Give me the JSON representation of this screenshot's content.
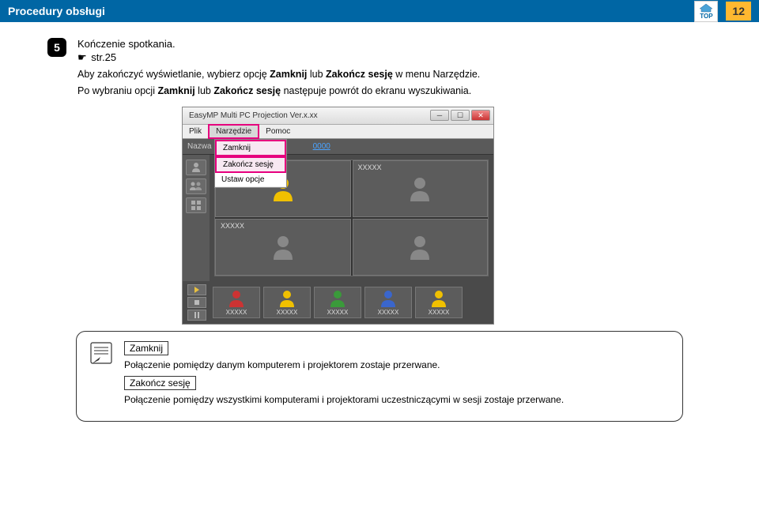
{
  "header": {
    "title": "Procedury obsługi",
    "page_number": "12",
    "top_label": "TOP"
  },
  "step": {
    "number": "5",
    "title": "Kończenie spotkania.",
    "ref_icon": "☛",
    "ref": "str.25",
    "para1_pre": "Aby zakończyć wyświetlanie, wybierz opcję ",
    "para1_b1": "Zamknij",
    "para1_mid": " lub ",
    "para1_b2": "Zakończ sesję",
    "para1_post": " w menu Narzędzie.",
    "para2_pre": "Po wybraniu opcji ",
    "para2_b1": "Zamknij",
    "para2_mid": " lub ",
    "para2_b2": "Zakończ sesję",
    "para2_post": " następuje powrót do ekranu wyszukiwania."
  },
  "app": {
    "title": "EasyMP Multi PC Projection Ver.x.xx",
    "menu": {
      "plik": "Plik",
      "narzedzie": "Narzędzie",
      "pomoc": "Pomoc"
    },
    "toolbar": {
      "nazwa": "Nazwa",
      "link": "0000"
    },
    "dropdown": {
      "zamknij": "Zamknij",
      "zakoncz": "Zakończ sesję",
      "ustaw": "Ustaw opcje"
    },
    "cells": {
      "a": "XXXXX",
      "b": "XXXXX",
      "c": "XXXXX"
    },
    "tiles": [
      "XXXXX",
      "XXXXX",
      "XXXXX",
      "XXXXX",
      "XXXXX"
    ]
  },
  "note": {
    "title1": "Zamknij",
    "text1": "Połączenie pomiędzy danym komputerem i projektorem zostaje przerwane.",
    "title2": "Zakończ sesję",
    "text2": "Połączenie pomiędzy wszystkimi komputerami i projektorami uczestniczącymi w sesji zostaje przerwane."
  },
  "colors": {
    "person_yellow": "#f0c000",
    "person_red": "#cc3333",
    "person_green": "#3a9a3a",
    "person_blue": "#3a66cc",
    "person_grey": "#888888"
  }
}
